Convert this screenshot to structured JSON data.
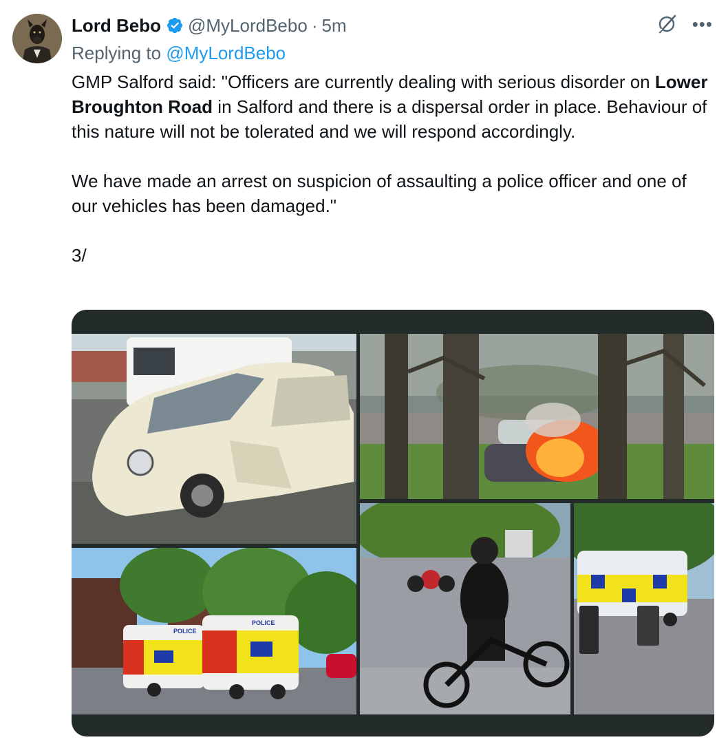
{
  "author": {
    "name": "Lord Bebo",
    "handle": "@MyLordBebo",
    "time": "5m",
    "separator": "·"
  },
  "reply": {
    "prefix": "Replying to",
    "handle": "@MyLordBebo"
  },
  "tweet": {
    "p1_a": "GMP Salford said: \"Officers are currently dealing with serious disorder on",
    "p1_bold": "Lower Broughton Road",
    "p1_b": " in Salford and there is a dispersal order in place. Behaviour of this nature will not be tolerated and we will respond accordingly.",
    "p2": "We have made an arrest on suspicion of assaulting a police officer and one of our vehicles has been damaged.\"",
    "p3": "3/"
  },
  "media": {
    "van_label": "POLICE"
  },
  "icons": {
    "verified": "verified-badge-icon",
    "grok": "grok-icon",
    "more": "more-options-icon"
  },
  "colors": {
    "verified": "#1d9bf0",
    "link": "#1d9bf0",
    "secondary": "#536471",
    "police_yellow": "#f2e21b",
    "police_blue": "#1e3aa8"
  }
}
